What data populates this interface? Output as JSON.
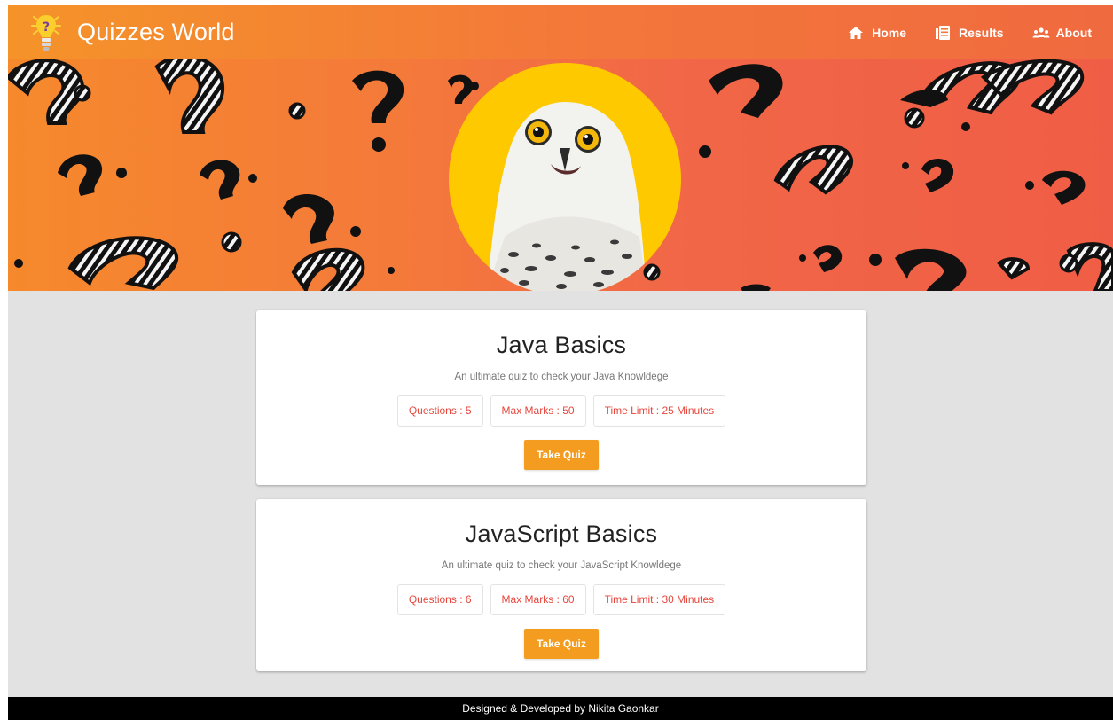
{
  "app": {
    "title": "Quizzes World"
  },
  "nav": {
    "items": [
      {
        "label": "Home",
        "icon": "home-icon"
      },
      {
        "label": "Results",
        "icon": "results-icon"
      },
      {
        "label": "About",
        "icon": "people-icon"
      }
    ]
  },
  "quizzes": [
    {
      "title": "Java Basics",
      "description": "An ultimate quiz to check your Java Knowldege",
      "questions": "Questions : 5",
      "max_marks": "Max Marks : 50",
      "time_limit": "Time Limit : 25 Minutes",
      "button": "Take Quiz"
    },
    {
      "title": "JavaScript Basics",
      "description": "An ultimate quiz to check your JavaScript Knowldege",
      "questions": "Questions : 6",
      "max_marks": "Max Marks : 60",
      "time_limit": "Time Limit : 30 Minutes",
      "button": "Take Quiz"
    }
  ],
  "footer": {
    "text": "Designed & Developed by Nikita Gaonkar"
  },
  "colors": {
    "header_start": "#f59329",
    "header_end": "#f06a3f",
    "accent_button": "#f39c1f",
    "chip_text": "#e8463c",
    "page_bg": "#e2e2e2",
    "footer_bg": "#000000"
  }
}
